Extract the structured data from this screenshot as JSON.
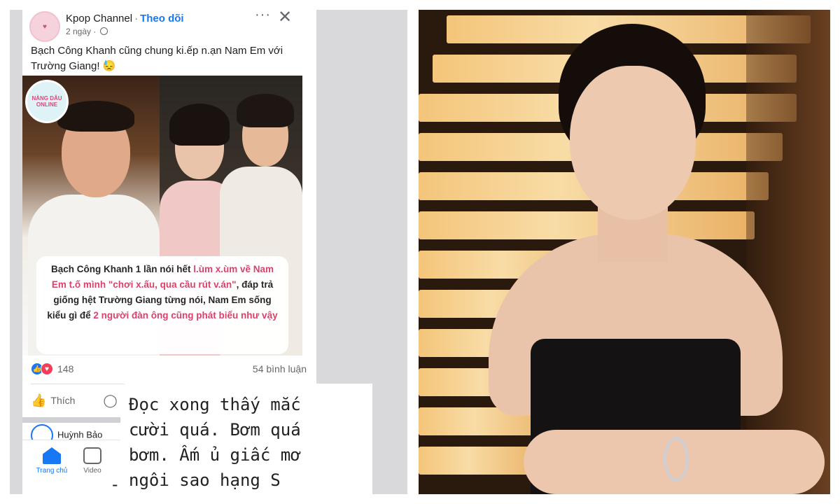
{
  "post": {
    "channel_name": "Kpop Channel",
    "separator": "·",
    "follow_label": "Theo dõi",
    "time_ago": "2 ngày ·",
    "more_icon": "more-dots-icon",
    "close_glyph": "✕",
    "caption": "Bạch Công Khanh cũng chung ki.ếp n.ạn Nam Em với Trường Giang! 😓",
    "image_badge": "NÀNG DÂU ONLINE",
    "overlay": {
      "p1": "Bạch Công Khanh 1 lần nói hết ",
      "h1": "l.ùm x.ùm về Nam Em t.ố mình \"chơi x.ấu, qua cầu rút v.án\"",
      "p2": ", đáp trả giống hệt Trường Giang từng nói, Nam Em sống kiểu gì để ",
      "h2": "2 người đàn ông cũng phát biểu như vậy"
    },
    "reaction_count": "148",
    "comment_count": "54 bình luận",
    "like_label": "Thích",
    "next_author": "Huỳnh Bảo"
  },
  "tabs": [
    {
      "label": "Trang chủ",
      "icon": "home-icon"
    },
    {
      "label": "Video",
      "icon": "video-icon"
    }
  ],
  "story_text": {
    "line1": "Đọc xong thấy mắc",
    "line2": "cười quá. Bơm quá",
    "line3": "bơm. Ấm ủ giấc mơ",
    "line4": "ngôi sao hạng S",
    "dash": "-"
  },
  "colors": {
    "facebook_blue": "#1877f2",
    "love_red": "#f33e58",
    "highlight_pink": "#d6436b"
  }
}
